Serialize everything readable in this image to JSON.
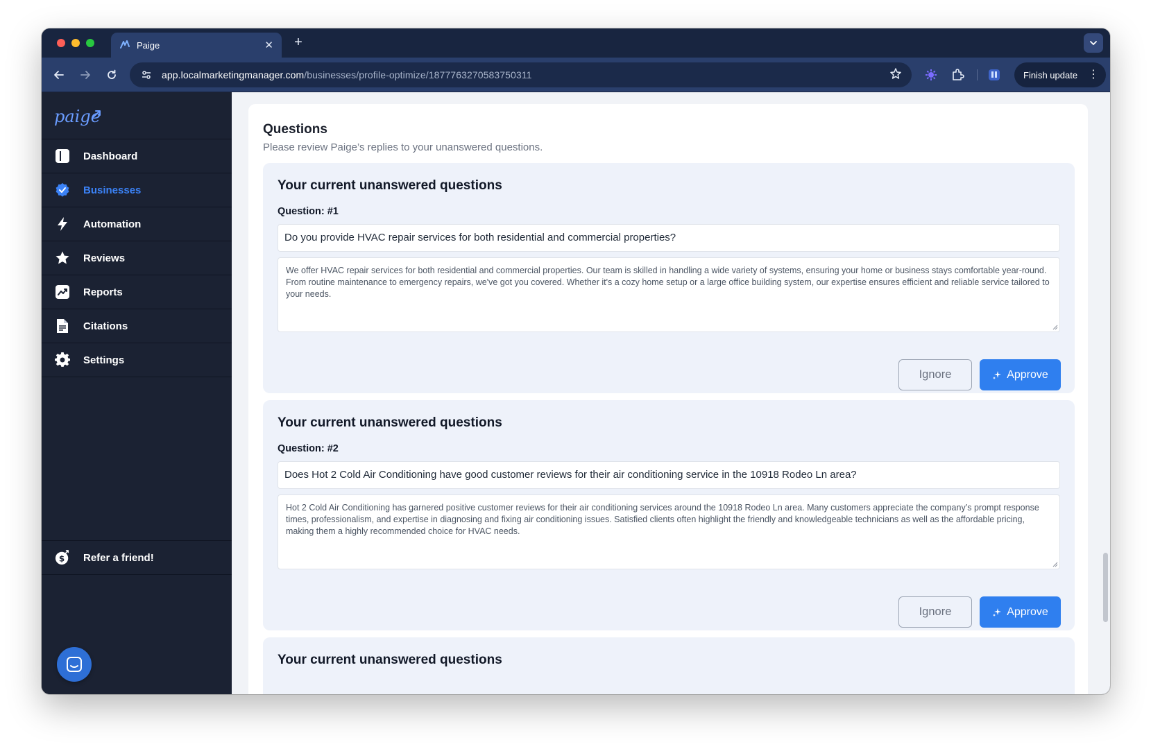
{
  "browser": {
    "tab_title": "Paige",
    "url_host": "app.localmarketingmanager.com",
    "url_path": "/businesses/profile-optimize/1877763270583750311",
    "finish_update_label": "Finish update"
  },
  "sidebar": {
    "logo_text": "paige",
    "items": [
      {
        "label": "Dashboard",
        "icon": "dashboard-icon",
        "active": false
      },
      {
        "label": "Businesses",
        "icon": "check-badge-icon",
        "active": true
      },
      {
        "label": "Automation",
        "icon": "lightning-icon",
        "active": false
      },
      {
        "label": "Reviews",
        "icon": "star-icon",
        "active": false
      },
      {
        "label": "Reports",
        "icon": "chart-icon",
        "active": false
      },
      {
        "label": "Citations",
        "icon": "document-icon",
        "active": false
      },
      {
        "label": "Settings",
        "icon": "gear-icon",
        "active": false
      }
    ],
    "refer_label": "Refer a friend!"
  },
  "main": {
    "section_title": "Questions",
    "section_subtitle": "Please review Paige’s replies to your unanswered questions.",
    "questions": [
      {
        "heading": "Your current unanswered questions",
        "number_label": "Question: #1",
        "question": "Do you provide HVAC repair services for both residential and commercial properties?",
        "answer": "We offer HVAC repair services for both residential and commercial properties. Our team is skilled in handling a wide variety of systems, ensuring your home or business stays comfortable year-round. From routine maintenance to emergency repairs, we've got you covered. Whether it's a cozy home setup or a large office building system, our expertise ensures efficient and reliable service tailored to your needs.",
        "ignore_label": "Ignore",
        "approve_label": "Approve"
      },
      {
        "heading": "Your current unanswered questions",
        "number_label": "Question: #2",
        "question": "Does Hot 2 Cold Air Conditioning have good customer reviews for their air conditioning service in the 10918 Rodeo Ln area?",
        "answer": "Hot 2 Cold Air Conditioning has garnered positive customer reviews for their air conditioning services around the 10918 Rodeo Ln area. Many customers appreciate the company’s prompt response times, professionalism, and expertise in diagnosing and fixing air conditioning issues. Satisfied clients often highlight the friendly and knowledgeable technicians as well as the affordable pricing, making them a highly recommended choice for HVAC needs.",
        "ignore_label": "Ignore",
        "approve_label": "Approve"
      },
      {
        "heading": "Your current unanswered questions"
      }
    ]
  },
  "colors": {
    "sidebar_bg": "#1b2233",
    "active_accent": "#3b82f6",
    "approve_bg": "#2f7fef",
    "card_bg": "#eef2fa"
  }
}
